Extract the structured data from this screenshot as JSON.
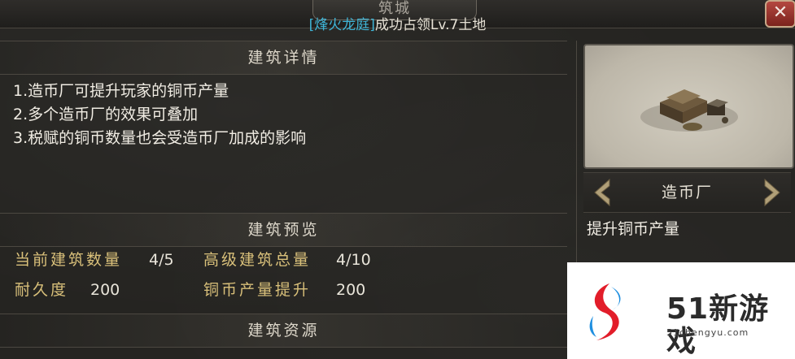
{
  "window": {
    "title": "筑城",
    "notice_highlight": "[烽火龙庭]",
    "notice_rest": "成功占领Lv.7土地",
    "close_glyph": "✕"
  },
  "details": {
    "header": "建筑详情",
    "lines": [
      "1.造币厂可提升玩家的铜币产量",
      "2.多个造币厂的效果可叠加",
      "3.税赋的铜币数量也会受造币厂加成的影响"
    ]
  },
  "preview_section": {
    "header": "建筑预览",
    "stats": [
      {
        "label": "当前建筑数量",
        "value": "4/5"
      },
      {
        "label": "高级建筑总量",
        "value": "4/10"
      },
      {
        "label": "耐久度",
        "value": "200"
      },
      {
        "label": "铜币产量提升",
        "value": "200"
      }
    ]
  },
  "resources_section": {
    "header": "建筑资源"
  },
  "building": {
    "name": "造币厂",
    "description": "提升铜币产量",
    "prev_icon": "chevron-left-icon",
    "next_icon": "chevron-right-icon"
  },
  "watermark": {
    "brand": "51新游戏",
    "url": "51chengyu.com"
  },
  "colors": {
    "highlight": "#3fb6d8",
    "stat_label": "#d9c07a",
    "close_button": "#9a2f28"
  }
}
